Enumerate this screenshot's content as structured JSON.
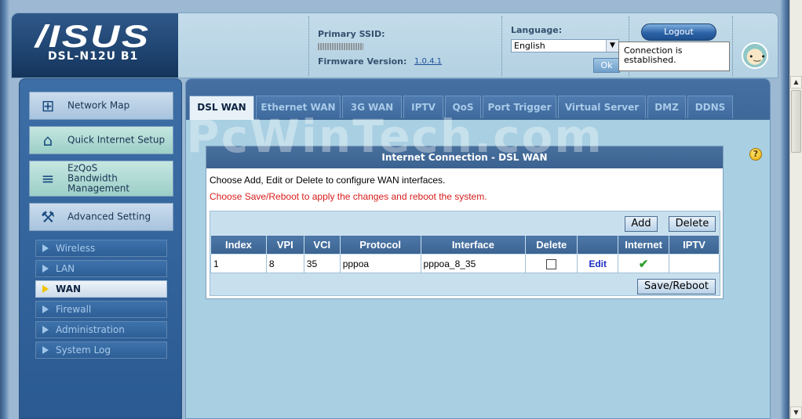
{
  "header": {
    "brand": "/ISUS",
    "model": "DSL-N12U B1",
    "primary_ssid_label": "Primary SSID:",
    "firmware_label": "Firmware Version:",
    "firmware_value": "1.0.4.1",
    "language_label": "Language:",
    "language_value": "English",
    "ok_label": "Ok",
    "logout_label": "Logout",
    "status_text": "Connection is established."
  },
  "sidebar": {
    "main_items": [
      {
        "label": "Network Map",
        "icon": "network-map-icon"
      },
      {
        "label": "Quick Internet Setup",
        "icon": "router-icon"
      },
      {
        "label": "EzQoS Bandwidth Management",
        "icon": "qos-icon"
      },
      {
        "label": "Advanced Setting",
        "icon": "wrench-icon"
      }
    ],
    "sub_items": [
      {
        "label": "Wireless"
      },
      {
        "label": "LAN"
      },
      {
        "label": "WAN",
        "active": true
      },
      {
        "label": "Firewall"
      },
      {
        "label": "Administration"
      },
      {
        "label": "System Log"
      }
    ]
  },
  "tabs": [
    "DSL WAN",
    "Ethernet WAN",
    "3G WAN",
    "IPTV",
    "QoS",
    "Port Trigger",
    "Virtual Server",
    "DMZ",
    "DDNS"
  ],
  "panel": {
    "title": "Internet Connection - DSL WAN",
    "desc1": "Choose Add, Edit or Delete to configure WAN interfaces.",
    "desc2": "Choose Save/Reboot to apply the changes and reboot the system.",
    "add_label": "Add",
    "delete_label": "Delete",
    "save_reboot_label": "Save/Reboot",
    "table": {
      "headers": [
        "Index",
        "VPI",
        "VCI",
        "Protocol",
        "Interface",
        "Delete",
        "",
        "Internet",
        "IPTV"
      ],
      "rows": [
        {
          "index": "1",
          "vpi": "8",
          "vci": "35",
          "protocol": "pppoa",
          "interface": "pppoa_8_35",
          "edit": "Edit",
          "internet": "check-icon"
        }
      ]
    }
  },
  "watermark": "PcWinTech.com",
  "colors": {
    "accent": "#3b6391",
    "warning_text": "#d81c1c",
    "link": "#1c4f9a"
  }
}
